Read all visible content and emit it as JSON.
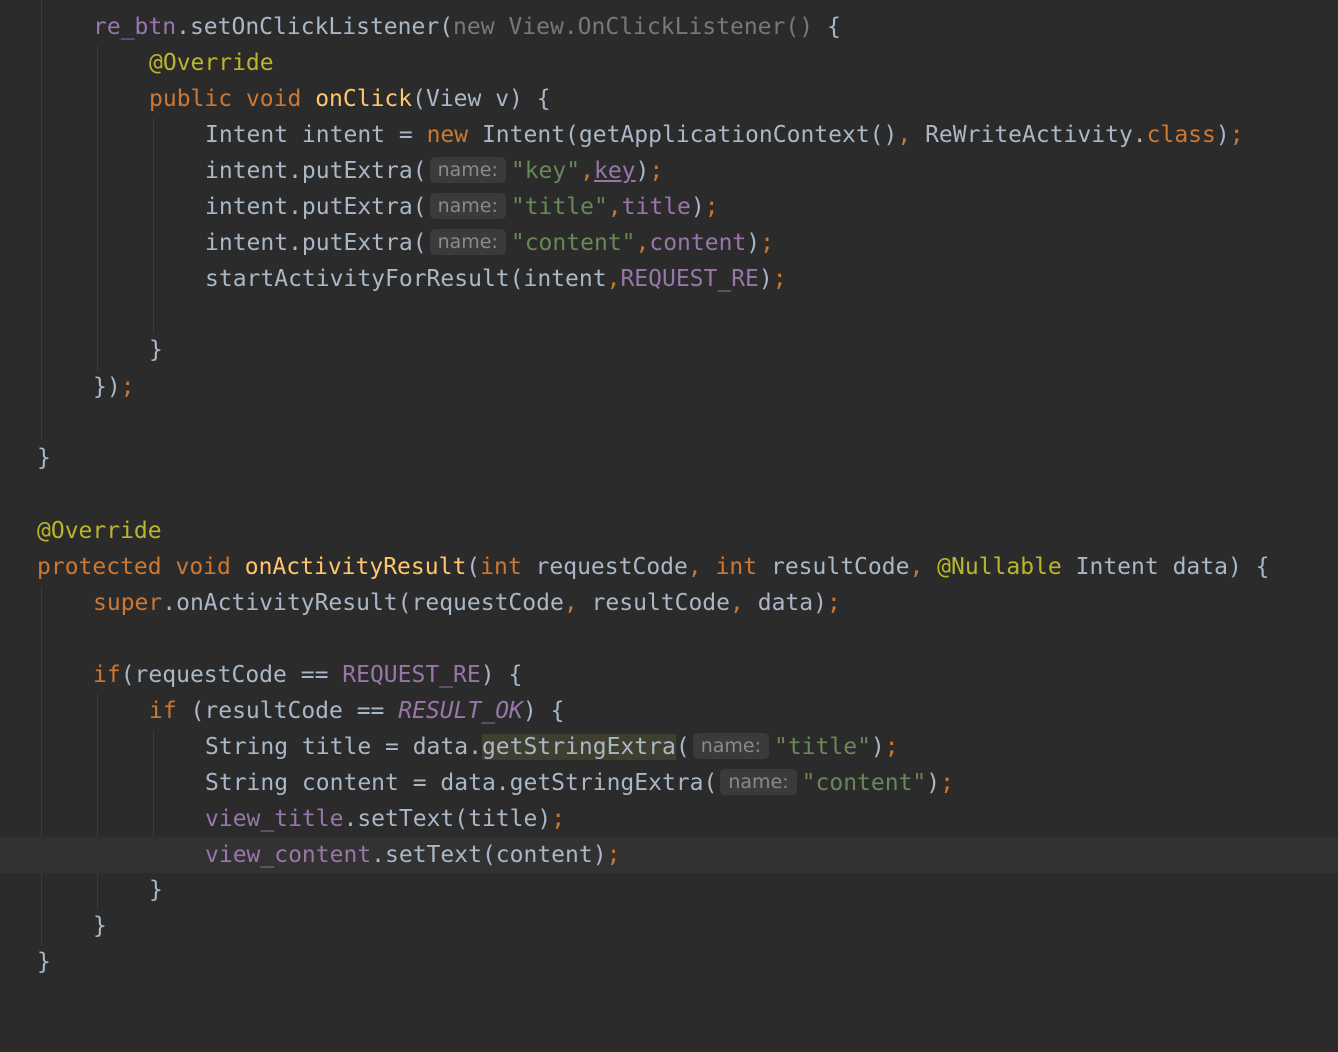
{
  "editor": {
    "lines": {
      "l01": [
        "re_btn",
        ".setOnClickListener(",
        "new ",
        "View.OnClickListener() ",
        "{"
      ],
      "l02": [
        "@Override"
      ],
      "l03": [
        "public ",
        "void ",
        "onClick",
        "(View v) {"
      ],
      "l04": [
        "Intent intent = ",
        "new ",
        "Intent(getApplicationContext()",
        ", ",
        "ReWriteActivity.",
        "class",
        ")",
        ";"
      ],
      "l05": [
        "intent.putExtra(",
        "name:",
        "\"key\"",
        ",",
        "key",
        ")",
        ";"
      ],
      "l06": [
        "intent.putExtra(",
        "name:",
        "\"title\"",
        ",",
        "title",
        ")",
        ";"
      ],
      "l07": [
        "intent.putExtra(",
        "name:",
        "\"content\"",
        ",",
        "content",
        ")",
        ";"
      ],
      "l08": [
        "startActivityForResult(intent",
        ",",
        "REQUEST_RE",
        ")",
        ";"
      ],
      "l09": [
        "}"
      ],
      "l10": [
        "})",
        ";"
      ],
      "l11": [
        "}"
      ],
      "l12": [
        "@Override"
      ],
      "l13": [
        "protected ",
        "void ",
        "onActivityResult",
        "(",
        "int ",
        "requestCode",
        ", ",
        "int ",
        "resultCode",
        ", ",
        "@Nullable ",
        "Intent data) {"
      ],
      "l14": [
        "super",
        ".onActivityResult(requestCode",
        ", ",
        "resultCode",
        ", ",
        "data)",
        ";"
      ],
      "l15": [
        "if",
        "(requestCode == ",
        "REQUEST_RE",
        ") {"
      ],
      "l16": [
        "if ",
        "(resultCode == ",
        "RESULT_OK",
        ") {"
      ],
      "l17": [
        "String title = data.",
        "getStringExtra",
        "(",
        "name:",
        "\"title\"",
        ")",
        ";"
      ],
      "l18": [
        "String content = data.getStringExtra(",
        "name:",
        "\"content\"",
        ")",
        ";"
      ],
      "l19": [
        "view_title",
        ".setText(title)",
        ";"
      ],
      "l20": [
        "view_content",
        ".setText(content)",
        ";"
      ],
      "l21": [
        "}"
      ],
      "l22": [
        "}"
      ],
      "l23": [
        "}"
      ]
    }
  }
}
